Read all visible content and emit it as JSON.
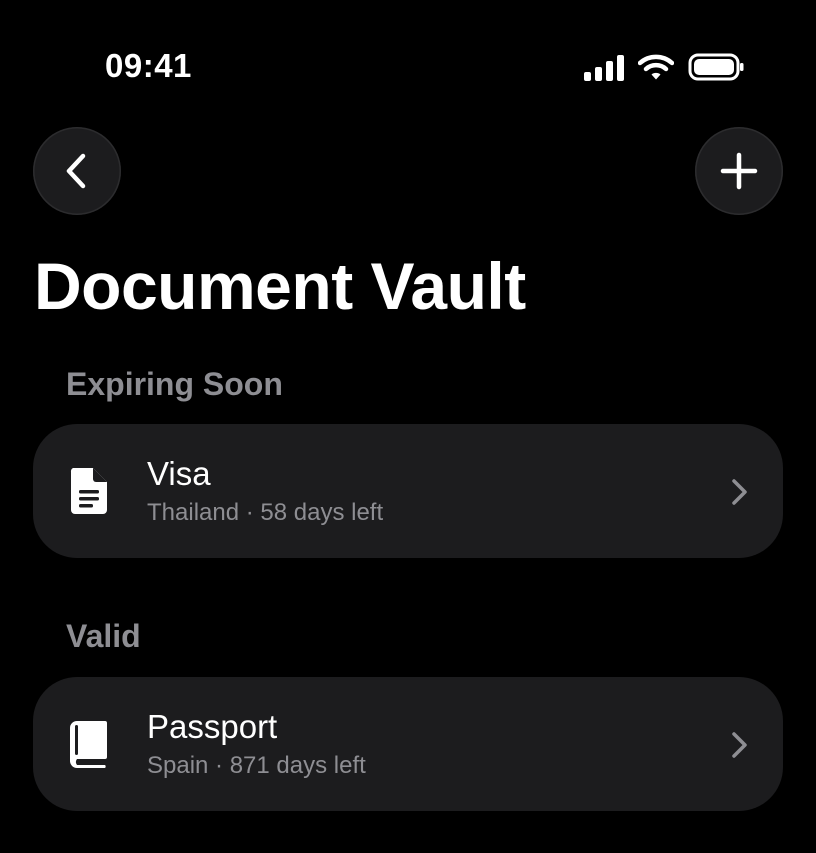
{
  "status_bar": {
    "time": "09:41",
    "icons": [
      "cellular-signal-icon",
      "wifi-icon",
      "battery-icon"
    ]
  },
  "nav": {
    "back_icon": "chevron-left-icon",
    "add_icon": "plus-icon"
  },
  "page_title": "Document Vault",
  "sections": [
    {
      "header": "Expiring Soon",
      "items": [
        {
          "title": "Visa",
          "subtitle": "Thailand · 58 days left",
          "icon": "document-icon"
        }
      ]
    },
    {
      "header": "Valid",
      "items": [
        {
          "title": "Passport",
          "subtitle": "Spain · 871 days left",
          "icon": "book-icon"
        }
      ]
    }
  ],
  "colors": {
    "background": "#000000",
    "card": "#1c1c1e",
    "secondary_text": "#8e8e93",
    "primary_text": "#ffffff"
  }
}
